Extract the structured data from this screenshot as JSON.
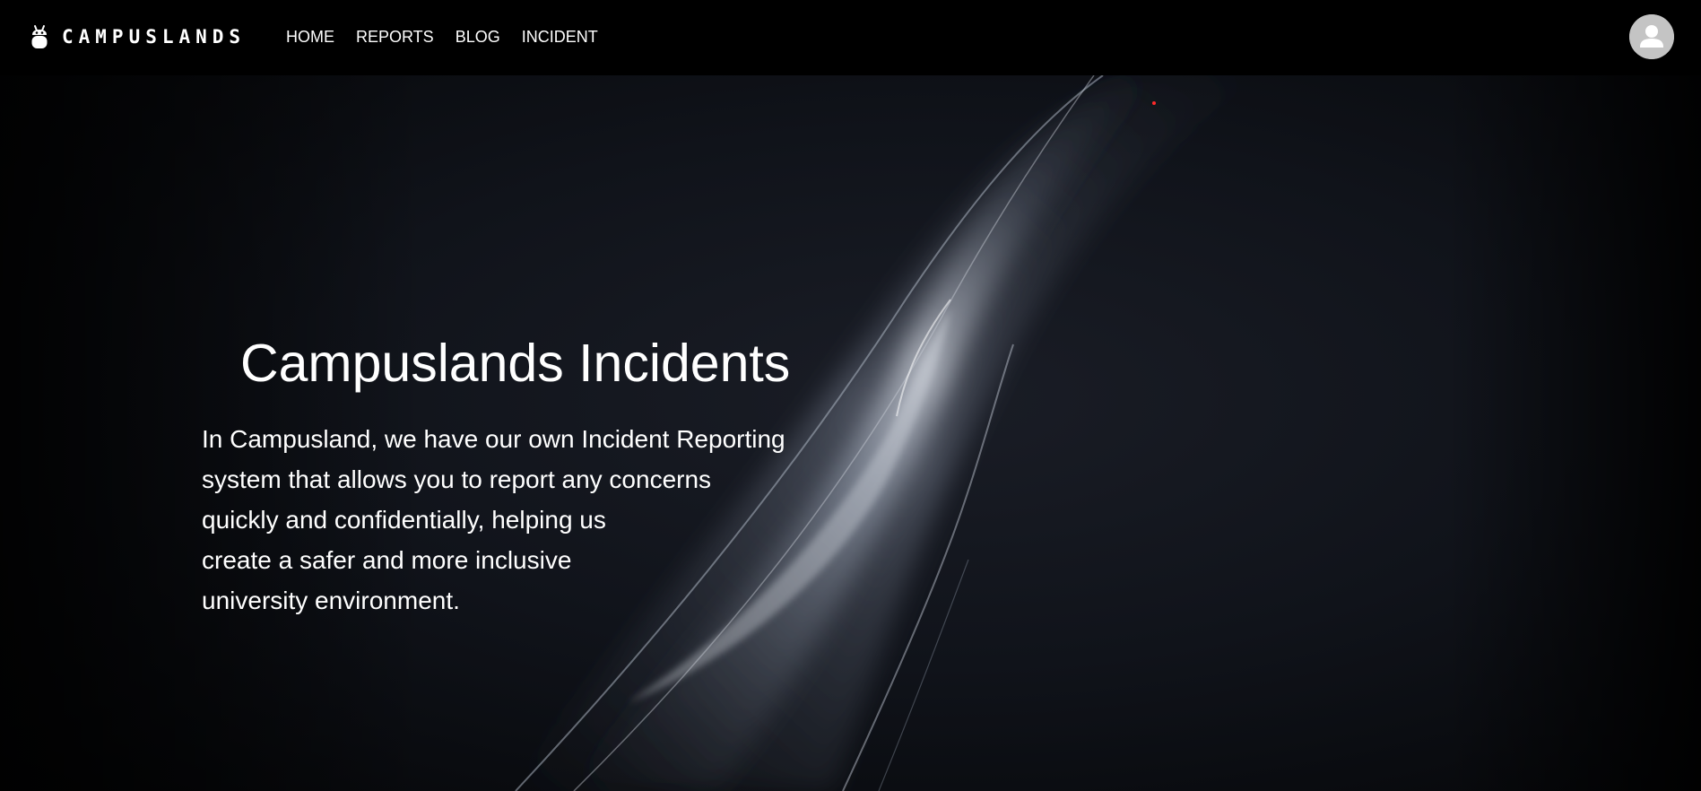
{
  "brand": {
    "logo_icon": "bug-robot-icon",
    "name": "CAMPUSLANDS"
  },
  "nav": {
    "items": [
      {
        "label": "HOME"
      },
      {
        "label": "REPORTS"
      },
      {
        "label": "BLOG"
      },
      {
        "label": "INCIDENT"
      }
    ]
  },
  "user": {
    "avatar_icon": "user-avatar-icon"
  },
  "hero": {
    "title": "Campuslands Incidents",
    "description_lines": [
      "In Campusland, we have our own Incident Reporting",
      "system that allows you to report any concerns",
      "quickly and confidentially, helping us",
      "create a safer and more inclusive",
      "university environment."
    ]
  },
  "colors": {
    "header_bg": "#000000",
    "hero_bg": "#0b0e14",
    "text": "#ffffff",
    "avatar_bg": "#c4c4c4",
    "accent_dot": "#ff2a2a"
  }
}
